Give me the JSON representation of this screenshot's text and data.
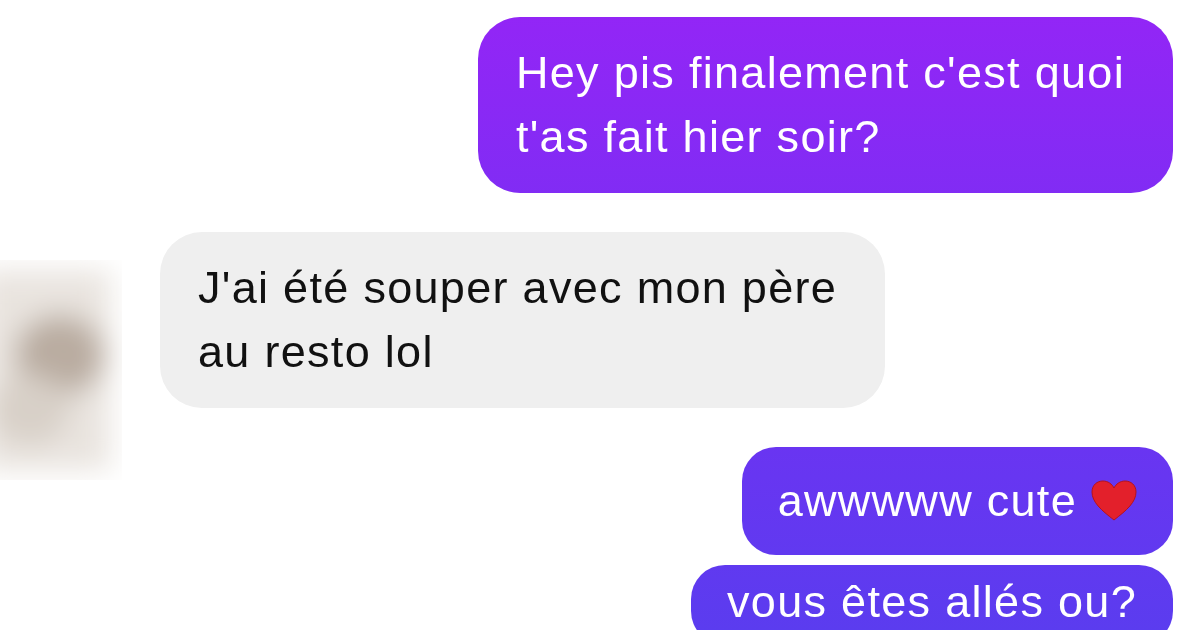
{
  "messages": [
    {
      "kind": "outgoing",
      "lines": [
        "Hey pis finalement c'est quoi",
        "t'as fait hier soir?"
      ],
      "has_heart": false
    },
    {
      "kind": "incoming",
      "lines": [
        "J'ai été souper avec mon père",
        "au resto lol"
      ],
      "has_heart": false
    },
    {
      "kind": "outgoing",
      "lines": [
        "awwwww cute"
      ],
      "has_heart": true
    },
    {
      "kind": "outgoing",
      "lines": [
        "vous êtes allés ou?"
      ],
      "has_heart": false
    }
  ]
}
